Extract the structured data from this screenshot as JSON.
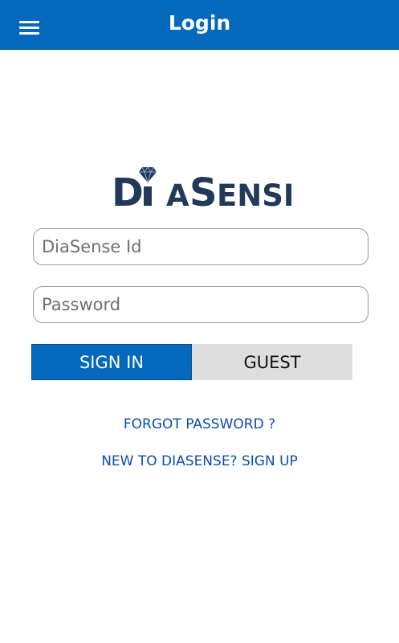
{
  "colors": {
    "app_bar": "#0468bd",
    "primary_button": "#0468bd",
    "secondary_button": "#dedede",
    "link": "#0b4ea8",
    "logo_text": "#213a59"
  },
  "header": {
    "title": "Login",
    "menu_icon": "hamburger-menu-icon"
  },
  "logo": {
    "text": "DiaSense",
    "icon": "diamond-icon"
  },
  "form": {
    "id_placeholder": "DiaSense Id",
    "password_placeholder": "Password",
    "signin_label": "SIGN IN",
    "guest_label": "GUEST"
  },
  "links": {
    "forgot_password": "FORGOT PASSWORD ?",
    "signup": "NEW TO DIASENSE? SIGN UP"
  }
}
